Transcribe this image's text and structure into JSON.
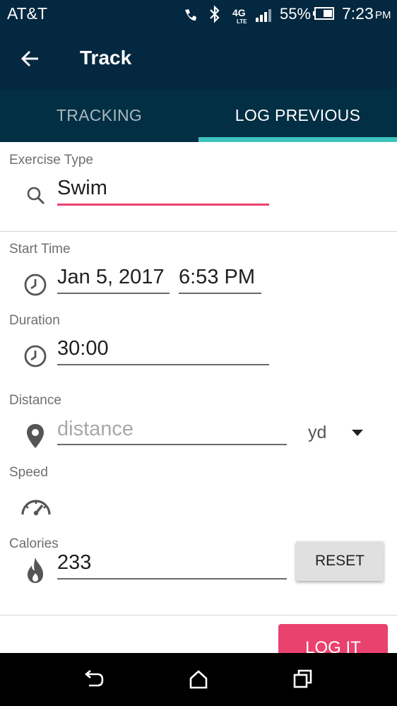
{
  "status_bar": {
    "carrier": "AT&T",
    "battery": "55%",
    "time": "7:23",
    "ampm": "PM",
    "network": "4G LTE"
  },
  "app_bar": {
    "title": "Track"
  },
  "tabs": [
    {
      "label": "TRACKING",
      "selected": false
    },
    {
      "label": "LOG PREVIOUS",
      "selected": true
    }
  ],
  "form": {
    "exercise_type": {
      "label": "Exercise Type",
      "value": "Swim"
    },
    "start_time": {
      "label": "Start Time",
      "date": "Jan 5, 2017",
      "time": "6:53 PM"
    },
    "duration": {
      "label": "Duration",
      "value": "30:00"
    },
    "distance": {
      "label": "Distance",
      "placeholder": "distance",
      "unit": "yd"
    },
    "speed": {
      "label": "Speed"
    },
    "calories": {
      "label": "Calories",
      "value": "233",
      "reset_label": "RESET"
    }
  },
  "actions": {
    "log_label": "LOG IT"
  },
  "colors": {
    "header": "#04283f",
    "tab_indicator": "#41c3bd",
    "accent_pink": "#e9426f"
  },
  "icons": [
    "back-arrow-icon",
    "search-icon",
    "clock-icon",
    "location-pin-icon",
    "speedometer-icon",
    "flame-icon",
    "dropdown-arrow-icon",
    "nav-back-icon",
    "nav-home-icon",
    "nav-recents-icon"
  ]
}
